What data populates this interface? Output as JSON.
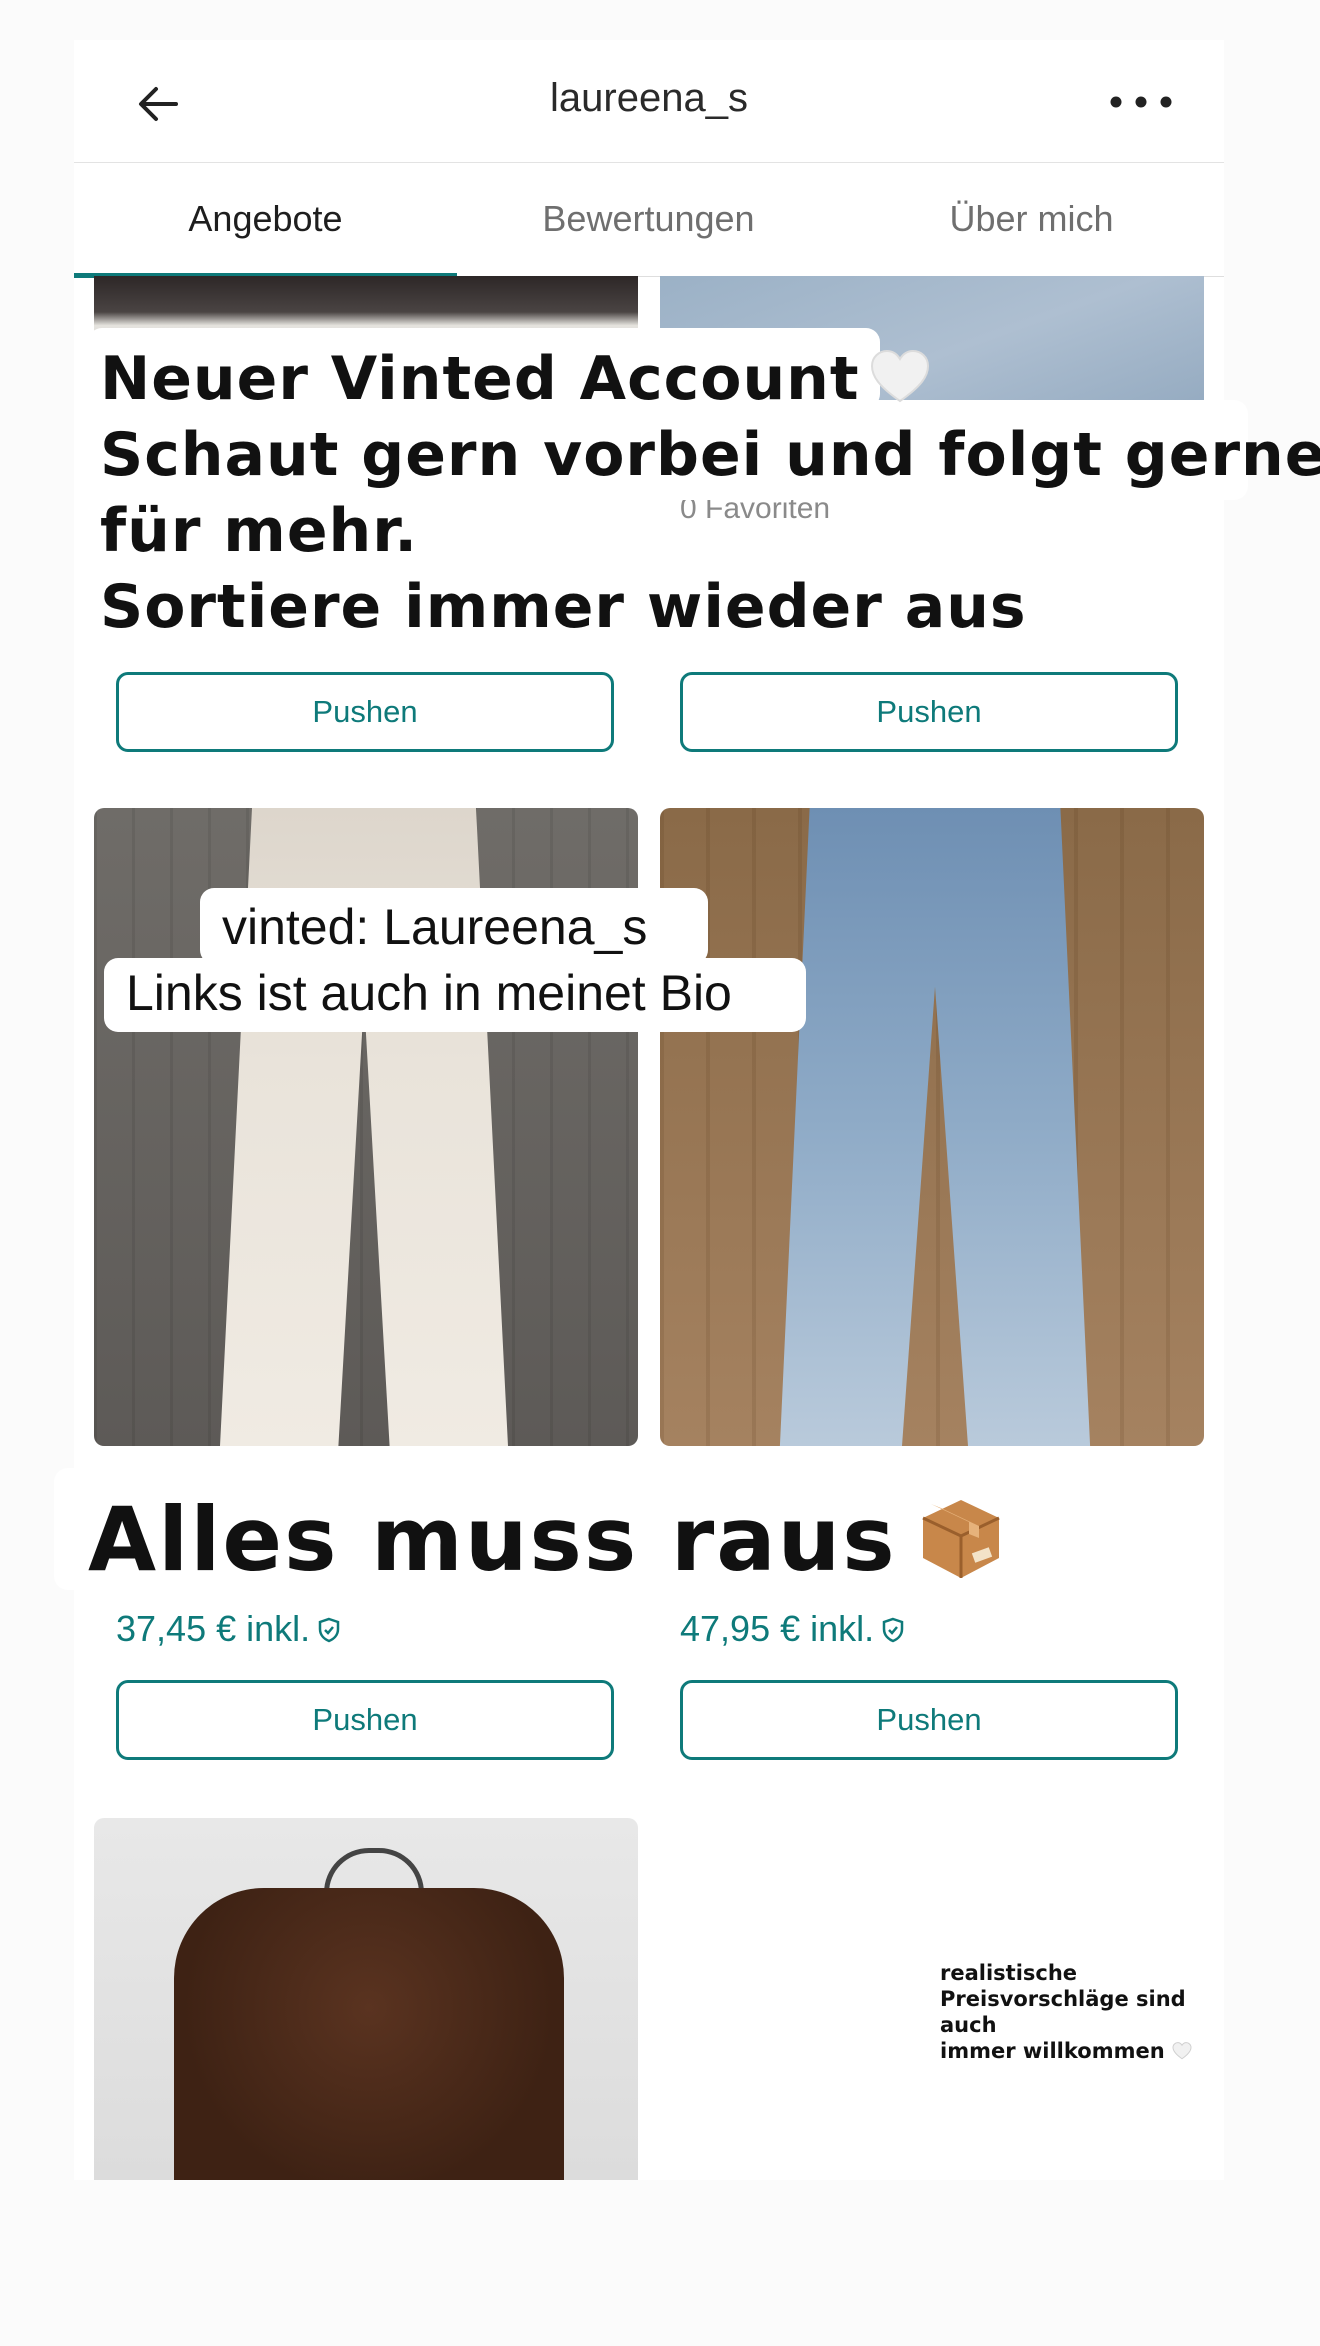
{
  "header": {
    "username": "laureena_s",
    "back_icon": "arrow-left-icon",
    "more_icon": "more-horizontal-icon"
  },
  "tabs": [
    {
      "label": "Angebote",
      "active": true
    },
    {
      "label": "Bewertungen",
      "active": false
    },
    {
      "label": "Über mich",
      "active": false
    }
  ],
  "items": {
    "top_left": {
      "push_label": "Pushen"
    },
    "top_right": {
      "favorites": "0 Favoriten",
      "push_label": "Pushen"
    },
    "mid_left": {
      "price": "37,45 € inkl.",
      "push_label": "Pushen"
    },
    "mid_right": {
      "price": "47,95 € inkl.",
      "push_label": "Pushen"
    }
  },
  "overlays": {
    "announcement": {
      "line1": "Neuer Vinted Account",
      "line2": "Schaut gern vorbei und folgt gerne",
      "line3": "für mehr.",
      "line4": "Sortiere immer wieder aus"
    },
    "vinted": {
      "line1": "vinted: Laureena_s",
      "line2": "Links ist auch in meinet Bio"
    },
    "sale": "Alles muss raus",
    "note": {
      "line1": "realistische",
      "line2": "Preisvorschläge sind auch",
      "line3": "immer willkommen"
    }
  },
  "colors": {
    "accent": "#0e7a7a",
    "background": "#ffffff"
  }
}
